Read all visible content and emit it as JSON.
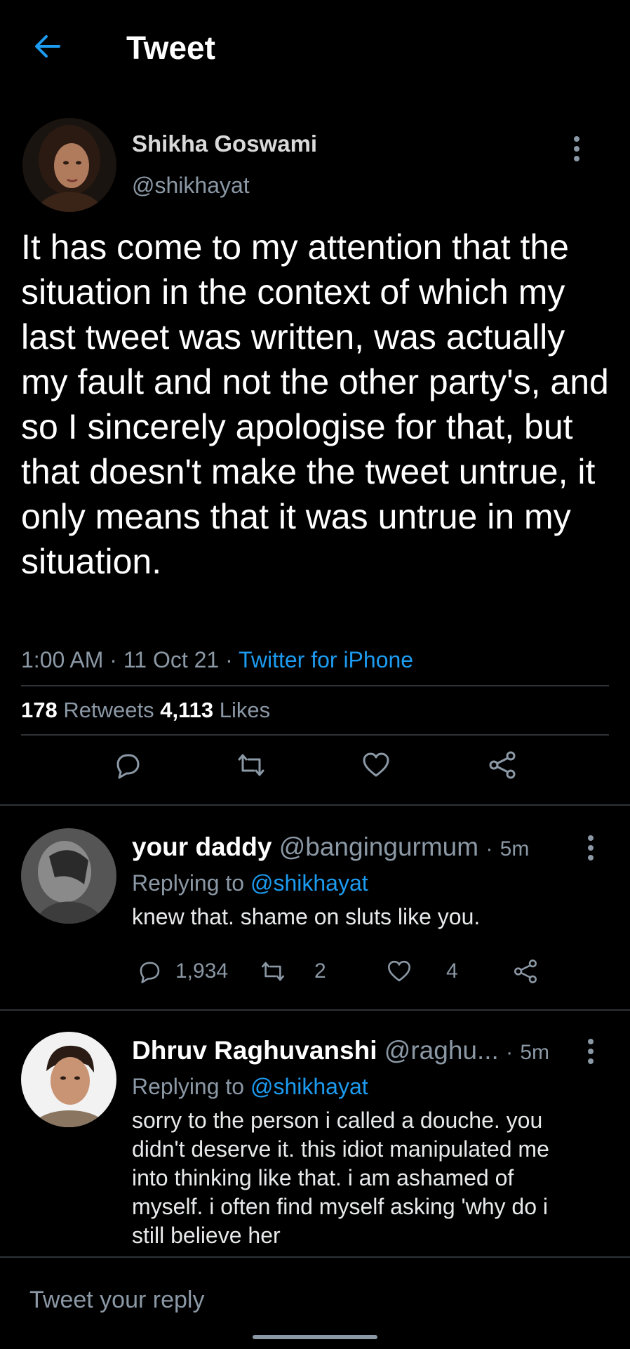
{
  "header": {
    "title": "Tweet"
  },
  "tweet": {
    "author_name": "Shikha Goswami",
    "author_handle": "@shikhayat",
    "text": "It has come to my attention that the situation in the context of which my last tweet was written, was actually my fault and not the other party's, and so I sincerely apologise for that, but that doesn't make the tweet untrue, it only means that it was untrue in my situation.",
    "time": "1:00 AM",
    "date": "11 Oct 21",
    "separator": "·",
    "source": "Twitter for iPhone",
    "retweets": "178",
    "retweets_label": "Retweets",
    "likes": "4,113",
    "likes_label": "Likes"
  },
  "replies": [
    {
      "name": "your daddy",
      "handle": "@bangingurmum",
      "time": "5m",
      "replying_label": "Replying to",
      "replying_to": "@shikhayat",
      "text": "knew that. shame on sluts like you.",
      "reply_count": "1,934",
      "retweet_count": "2",
      "like_count": "4"
    },
    {
      "name": "Dhruv Raghuvanshi",
      "handle": "@raghu...",
      "time": "5m",
      "replying_label": "Replying to",
      "replying_to": "@shikhayat",
      "text": "sorry to the person i called a douche. you didn't deserve it. this idiot manipulated me into thinking like that. i am ashamed of myself. i often find myself asking 'why do i still believe her"
    }
  ],
  "composer": {
    "placeholder": "Tweet your reply"
  },
  "colors": {
    "background": "#000000",
    "accent": "#1d9bf0",
    "muted": "#8b98a5",
    "divider": "#2f3336"
  }
}
